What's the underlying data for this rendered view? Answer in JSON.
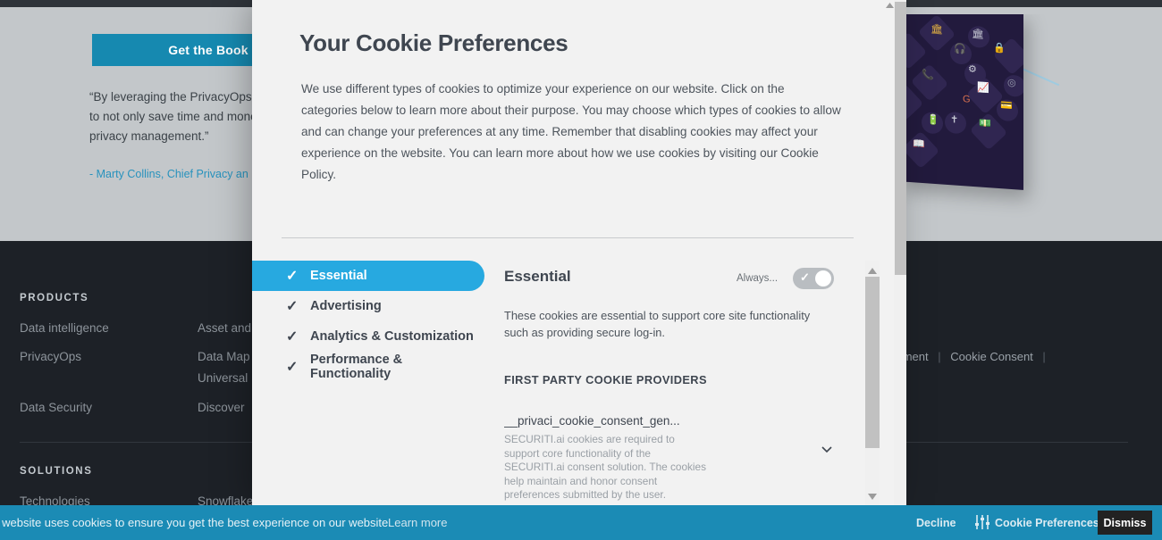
{
  "background": {
    "cta_button": "Get the Book",
    "quote": "“By leveraging the PrivacyOps co\nto not only save time and money\nprivacy management.”",
    "quote_attribution": "- Marty Collins, Chief Privacy an",
    "footer": {
      "products_heading": "PRODUCTS",
      "products_col1": [
        "Data intelligence",
        "PrivacyOps",
        "Data Security"
      ],
      "products_col2": [
        "Asset and",
        "Data Map",
        "Universal",
        "Discover"
      ],
      "solutions_heading": "SOLUTIONS",
      "solutions_col1": [
        "Technologies"
      ],
      "solutions_col2": [
        "Snowflake"
      ],
      "right_links": [
        "sessment",
        "Cookie Consent"
      ]
    }
  },
  "modal": {
    "title": "Your Cookie Preferences",
    "description": "We use different types of cookies to optimize your experience on our website. Click on the categories below to learn more about their purpose. You may choose which types of cookies to allow and can change your preferences at any time. Remember that disabling cookies may affect your experience on the website. You can learn more about how we use cookies by visiting our Cookie Policy.",
    "categories": [
      {
        "label": "Essential",
        "checked": true,
        "active": true
      },
      {
        "label": "Advertising",
        "checked": true,
        "active": false
      },
      {
        "label": "Analytics & Customization",
        "checked": true,
        "active": false
      },
      {
        "label": "Performance & Functionality",
        "checked": true,
        "active": false
      }
    ],
    "detail": {
      "title": "Essential",
      "always_label": "Always...",
      "toggle_state": "on",
      "description": "These cookies are essential to support core site functionality such as providing secure log-in.",
      "providers_heading": "FIRST PARTY COOKIE PROVIDERS",
      "providers": [
        {
          "name": "__privaci_cookie_consent_gen...",
          "description": "SECURITI.ai cookies are required to support core functionality of the SECURITI.ai consent solution. The cookies help maintain and honor consent preferences submitted by the user."
        }
      ]
    }
  },
  "banner": {
    "text": "s website uses cookies to ensure you get the best experience on our website.",
    "learn_more": "Learn more",
    "decline": "Decline",
    "preferences": "Cookie Preferences",
    "dismiss": "Dismiss"
  },
  "colors": {
    "accent_blue": "#27a9e0",
    "banner_blue": "#1b8bb5",
    "cta_blue": "#1689b0",
    "footer_dark": "#1d2127",
    "modal_bg": "#f2f2f2",
    "toggle_gray": "#b9bdc1"
  }
}
